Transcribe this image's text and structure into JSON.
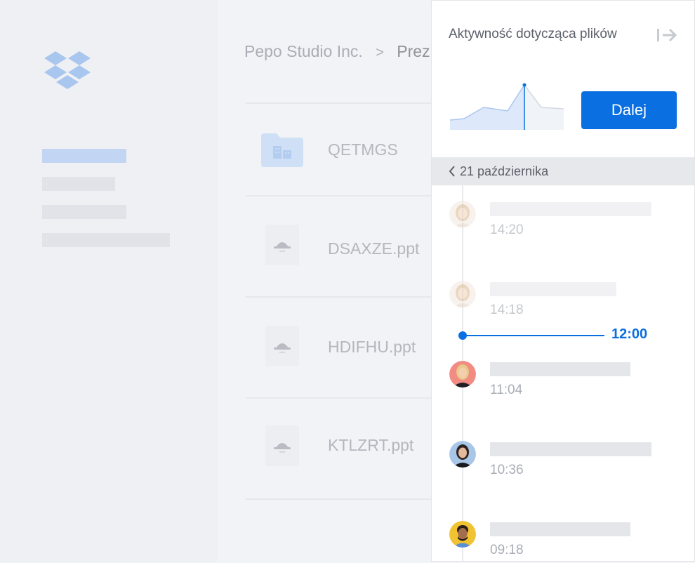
{
  "app": {
    "logo_icon": "dropbox-logo-icon",
    "accent": "#0a6fe0"
  },
  "breadcrumb": {
    "parent": "Pepo Studio Inc.",
    "separator": ">",
    "current": "Prez"
  },
  "files": [
    {
      "name": "QETMGS",
      "icon": "folder-icon"
    },
    {
      "name": "DSAXZE.ppt",
      "icon": "presentation-file-icon"
    },
    {
      "name": "HDIFHU.ppt",
      "icon": "presentation-file-icon"
    },
    {
      "name": "KTLZRT.ppt",
      "icon": "presentation-file-icon"
    }
  ],
  "panel": {
    "title": "Aktywność dotycząca plików",
    "collapse_icon": "collapse-panel-icon",
    "next_button": "Dalej",
    "date": "21 października",
    "now_time": "12:00",
    "entries": [
      {
        "time": "14:20",
        "avatar": "avatar-woman-blonde"
      },
      {
        "time": "14:18",
        "avatar": "avatar-woman-blonde"
      },
      {
        "time": "11:04",
        "avatar": "avatar-woman-red-bg"
      },
      {
        "time": "10:36",
        "avatar": "avatar-woman-blue-bg"
      },
      {
        "time": "09:18",
        "avatar": "avatar-man-yellow-bg"
      }
    ]
  }
}
